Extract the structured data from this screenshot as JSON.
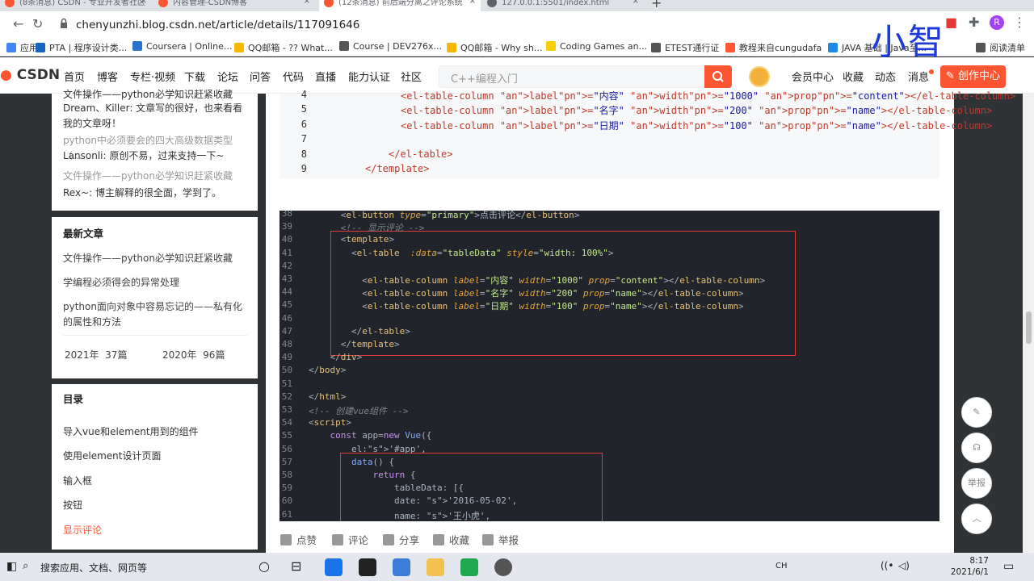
{
  "tabs": [
    {
      "title": "(8条消息) CSDN - 专业开发者社区",
      "color": "#fc5531"
    },
    {
      "title": "内容管理-CSDN博客",
      "color": "#fc5531"
    },
    {
      "title": "(12条消息) 前后端分离之评论系统",
      "color": "#fc5531"
    },
    {
      "title": "127.0.0.1:5501/index.html",
      "color": "#5f6368"
    }
  ],
  "toolbar": {
    "url": "chenyunzhi.blog.csdn.net/article/details/117091646"
  },
  "bookmarks": [
    {
      "label": "应用",
      "color": "#4285f4"
    },
    {
      "label": "PTA | 程序设计类...",
      "color": "#1565c0"
    },
    {
      "label": "Coursera | Online...",
      "color": "#2a73cc"
    },
    {
      "label": "QQ邮箱 - ?? What...",
      "color": "#f5b800"
    },
    {
      "label": "Course | DEV276x...",
      "color": "#555"
    },
    {
      "label": "QQ邮箱 - Why sh...",
      "color": "#f5b800"
    },
    {
      "label": "Coding Games an...",
      "color": "#f5cf00"
    },
    {
      "label": "ETEST通行证",
      "color": "#555"
    },
    {
      "label": "教程来自cungudafa",
      "color": "#fc5531"
    },
    {
      "label": "JAVA 基础 | Java至...",
      "color": "#1e88e5"
    },
    {
      "label": "阅读清单",
      "color": "#555"
    }
  ],
  "watermark": "小智",
  "csdn": {
    "logo": "CSDN",
    "nav": [
      "首页",
      "博客",
      "专栏·视频",
      "下载",
      "论坛",
      "问答",
      "代码",
      "直播",
      "能力认证",
      "社区"
    ],
    "search_placeholder": "C++编程入门",
    "right": [
      "会员中心",
      "收藏",
      "动态",
      "消息"
    ],
    "create": "创作中心"
  },
  "sidebar": {
    "comments": [
      {
        "t": "文件操作——python必学知识赶紧收藏",
        "a": false
      },
      {
        "t": "Dream、Killer: 文章写的很好，也来看看我的文章呀！",
        "a": false
      },
      {
        "t": "python中必须要会的四大高级数据类型（...",
        "a": true
      },
      {
        "t": "Lansonli: 原创不易，过来支持一下~",
        "a": false
      },
      {
        "t": "文件操作——python必学知识赶紧收藏",
        "a": true
      },
      {
        "t": "Rex~: 博主解释的很全面，学到了。",
        "a": false
      }
    ],
    "latest_title": "最新文章",
    "latest": [
      "文件操作——python必学知识赶紧收藏",
      "学编程必须得会的异常处理",
      "python面向对象中容易忘记的——私有化的属性和方法"
    ],
    "archive": [
      "2021年  37篇",
      "2020年  96篇"
    ],
    "toc_title": "目录",
    "toc": [
      "导入vue和element用到的组件",
      "使用element设计页面",
      "输入框",
      "按钮",
      "显示评论"
    ]
  },
  "code1": [
    {
      "n": "4",
      "t": "<el-table-column label=\"内容\" width=\"1000\" prop=\"content\"></el-table-column>"
    },
    {
      "n": "5",
      "t": "<el-table-column label=\"名字\" width=\"200\" prop=\"name\"></el-table-column>"
    },
    {
      "n": "6",
      "t": "<el-table-column label=\"日期\" width=\"100\" prop=\"name\"></el-table-column>"
    },
    {
      "n": "7",
      "t": ""
    },
    {
      "n": "8",
      "t": "</el-table>"
    },
    {
      "n": "9",
      "t": "</template>"
    }
  ],
  "code2": [
    {
      "n": "38",
      "t": "      <el-button type=\"primary\">点击评论</el-button>"
    },
    {
      "n": "39",
      "t": "      <!-- 显示评论 -->"
    },
    {
      "n": "40",
      "t": "      <template>"
    },
    {
      "n": "41",
      "t": "        <el-table  :data=\"tableData\" style=\"width: 100%\">"
    },
    {
      "n": "42",
      "t": ""
    },
    {
      "n": "43",
      "t": "          <el-table-column label=\"内容\" width=\"1000\" prop=\"content\"></el-table-column>"
    },
    {
      "n": "44",
      "t": "          <el-table-column label=\"名字\" width=\"200\" prop=\"name\"></el-table-column>"
    },
    {
      "n": "45",
      "t": "          <el-table-column label=\"日期\" width=\"100\" prop=\"name\"></el-table-column>"
    },
    {
      "n": "46",
      "t": ""
    },
    {
      "n": "47",
      "t": "        </el-table>"
    },
    {
      "n": "48",
      "t": "      </template>"
    },
    {
      "n": "49",
      "t": "    </div>"
    },
    {
      "n": "50",
      "t": "</body>"
    },
    {
      "n": "51",
      "t": ""
    },
    {
      "n": "52",
      "t": "</html>"
    },
    {
      "n": "53",
      "t": "<!-- 创建vue组件 -->"
    },
    {
      "n": "54",
      "t": "<script>"
    },
    {
      "n": "55",
      "t": "    const app=new Vue({"
    },
    {
      "n": "56",
      "t": "        el:'#app',"
    },
    {
      "n": "57",
      "t": "        data() {"
    },
    {
      "n": "58",
      "t": "            return {"
    },
    {
      "n": "59",
      "t": "                tableData: [{"
    },
    {
      "n": "60",
      "t": "                date: '2016-05-02',"
    },
    {
      "n": "61",
      "t": "                name: '王小虎',"
    }
  ],
  "actions": [
    "点赞",
    "评论",
    "分享",
    "收藏",
    "举报"
  ],
  "float": {
    "report": "举报"
  },
  "taskbar": {
    "search": "搜索应用、文档、网页等",
    "time": "8:17",
    "date": "2021/6/1",
    "lang": "CH"
  }
}
